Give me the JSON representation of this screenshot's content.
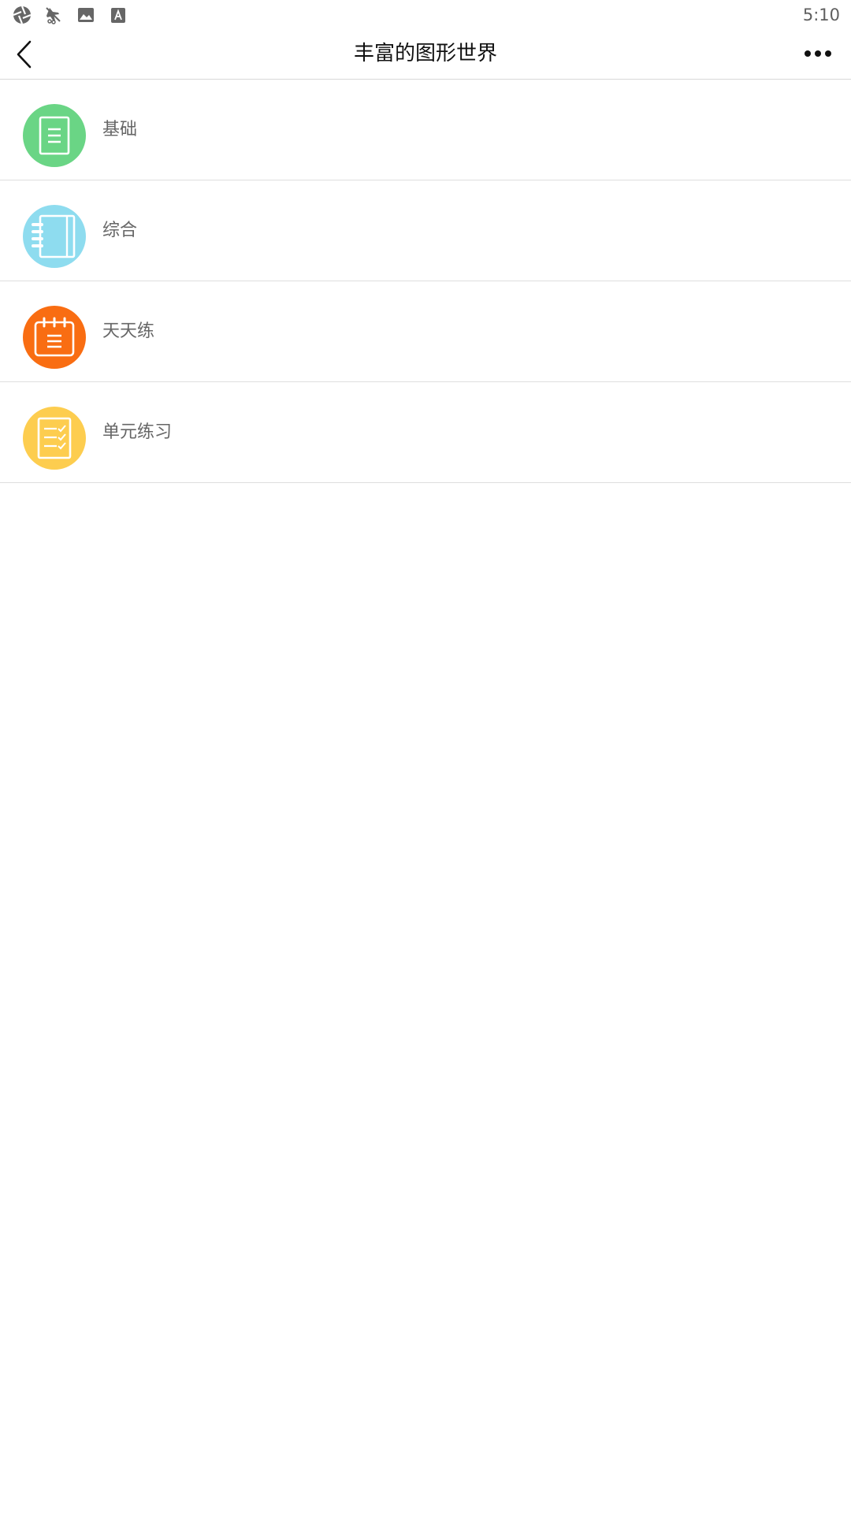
{
  "status_bar": {
    "time": "5:10",
    "icons": [
      "aperture-icon",
      "flight-off-icon",
      "image-icon",
      "font-icon"
    ]
  },
  "header": {
    "title": "丰富的图形世界",
    "back_icon": "chevron-left-icon",
    "more_icon": "more-horizontal-icon"
  },
  "menu": {
    "items": [
      {
        "label": "基础",
        "icon": "document-lines-icon",
        "color": "#6ad585"
      },
      {
        "label": "综合",
        "icon": "notebook-icon",
        "color": "#8edcef"
      },
      {
        "label": "天天练",
        "icon": "calendar-notepad-icon",
        "color": "#f96d12"
      },
      {
        "label": "单元练习",
        "icon": "checklist-icon",
        "color": "#fdcd4f"
      }
    ]
  }
}
